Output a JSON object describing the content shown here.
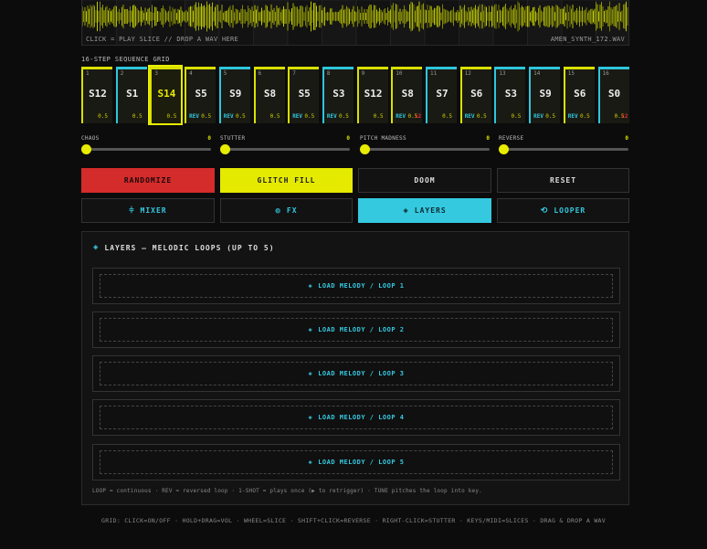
{
  "waveform": {
    "hint": "CLICK = PLAY SLICE  //  DROP A WAV HERE",
    "filename": "AMEN_SYNTH_172.WAV",
    "color": "#c6d000"
  },
  "grid": {
    "label": "16-STEP SEQUENCE GRID",
    "steps": [
      {
        "num": "1",
        "slice": "S12",
        "rev": "",
        "vol": "0.5",
        "stutter": "",
        "color": "yellow",
        "active": false
      },
      {
        "num": "2",
        "slice": "S1",
        "rev": "",
        "vol": "0.5",
        "stutter": "",
        "color": "cyan",
        "active": false
      },
      {
        "num": "3",
        "slice": "S14",
        "rev": "",
        "vol": "0.5",
        "stutter": "",
        "color": "yellow",
        "active": true
      },
      {
        "num": "4",
        "slice": "S5",
        "rev": "REV",
        "vol": "0.5",
        "stutter": "",
        "color": "yellow",
        "active": false
      },
      {
        "num": "5",
        "slice": "S9",
        "rev": "REV",
        "vol": "0.5",
        "stutter": "",
        "color": "cyan",
        "active": false
      },
      {
        "num": "6",
        "slice": "S8",
        "rev": "",
        "vol": "0.5",
        "stutter": "",
        "color": "yellow",
        "active": false
      },
      {
        "num": "7",
        "slice": "S5",
        "rev": "REV",
        "vol": "0.5",
        "stutter": "",
        "color": "yellow",
        "active": false
      },
      {
        "num": "8",
        "slice": "S3",
        "rev": "REV",
        "vol": "0.5",
        "stutter": "",
        "color": "cyan",
        "active": false
      },
      {
        "num": "9",
        "slice": "S12",
        "rev": "",
        "vol": "0.5",
        "stutter": "",
        "color": "yellow",
        "active": false
      },
      {
        "num": "10",
        "slice": "S8",
        "rev": "REV",
        "vol": "0.5",
        "stutter": "x2",
        "color": "yellow",
        "active": false
      },
      {
        "num": "11",
        "slice": "S7",
        "rev": "",
        "vol": "0.5",
        "stutter": "",
        "color": "cyan",
        "active": false
      },
      {
        "num": "12",
        "slice": "S6",
        "rev": "REV",
        "vol": "0.5",
        "stutter": "",
        "color": "yellow",
        "active": false
      },
      {
        "num": "13",
        "slice": "S3",
        "rev": "",
        "vol": "0.5",
        "stutter": "",
        "color": "cyan",
        "active": false
      },
      {
        "num": "14",
        "slice": "S9",
        "rev": "REV",
        "vol": "0.5",
        "stutter": "",
        "color": "cyan",
        "active": false
      },
      {
        "num": "15",
        "slice": "S6",
        "rev": "REV",
        "vol": "0.5",
        "stutter": "",
        "color": "yellow",
        "active": false
      },
      {
        "num": "16",
        "slice": "S0",
        "rev": "",
        "vol": "0.5",
        "stutter": "x2",
        "color": "cyan",
        "active": false
      }
    ]
  },
  "sliders": [
    {
      "label": "CHAOS",
      "value": "0"
    },
    {
      "label": "STUTTER",
      "value": "0"
    },
    {
      "label": "PITCH MADNESS",
      "value": "0"
    },
    {
      "label": "REVERSE",
      "value": "0"
    }
  ],
  "actions": {
    "randomize": "RANDOMIZE",
    "glitch_fill": "GLITCH FILL",
    "doom": "DOOM",
    "reset": "RESET"
  },
  "tabs": {
    "mixer": "MIXER",
    "fx": "FX",
    "layers": "LAYERS",
    "looper": "LOOPER"
  },
  "layers_panel": {
    "title": "LAYERS — MELODIC LOOPS (UP TO 5)",
    "loops": [
      "LOAD MELODY / LOOP 1",
      "LOAD MELODY / LOOP 2",
      "LOAD MELODY / LOOP 3",
      "LOAD MELODY / LOOP 4",
      "LOAD MELODY / LOOP 5"
    ],
    "note": "LOOP = continuous · REV = reversed loop · 1-SHOT = plays once (▶ to retrigger) · TUNE pitches the loop into key."
  },
  "footer": "GRID: CLICK=ON/OFF · HOLD+DRAG=VOL · WHEEL=SLICE · SHIFT+CLICK=REVERSE · RIGHT-CLICK=STUTTER · KEYS/MIDI=SLICES · DRAG & DROP A WAV",
  "colors": {
    "yellow": "#d9e000",
    "cyan": "#2ec6dc",
    "red": "#d42b2b"
  }
}
